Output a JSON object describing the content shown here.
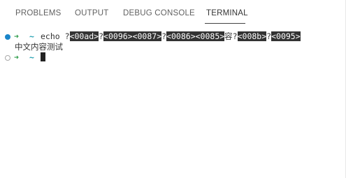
{
  "tabs": [
    {
      "label": "PROBLEMS",
      "active": false
    },
    {
      "label": "OUTPUT",
      "active": false
    },
    {
      "label": "DEBUG CONSOLE",
      "active": false
    },
    {
      "label": "TERMINAL",
      "active": true
    }
  ],
  "terminal": {
    "prompt_arrow": "➜",
    "prompt_dir": "~",
    "command": {
      "prefix": "echo ",
      "segments": [
        {
          "text": "?",
          "inverted": false
        },
        {
          "text": "<00ad>",
          "inverted": true
        },
        {
          "text": "?",
          "inverted": false
        },
        {
          "text": "<0096><0087>",
          "inverted": true
        },
        {
          "text": "?",
          "inverted": false
        },
        {
          "text": "<0086><0085>",
          "inverted": true
        },
        {
          "text": "容",
          "inverted": false
        },
        {
          "text": "?",
          "inverted": false
        },
        {
          "text": "<008b>",
          "inverted": true
        },
        {
          "text": "?",
          "inverted": false
        },
        {
          "text": "<0095>",
          "inverted": true
        }
      ]
    },
    "output_line": "中文内容测试"
  },
  "colors": {
    "active_dot": "#1a85c9",
    "prompt_arrow": "#2e9c4a",
    "prompt_dir": "#27a2b3"
  },
  "icons": {
    "command_status_active": "filled-circle",
    "command_status_idle": "hollow-circle"
  }
}
